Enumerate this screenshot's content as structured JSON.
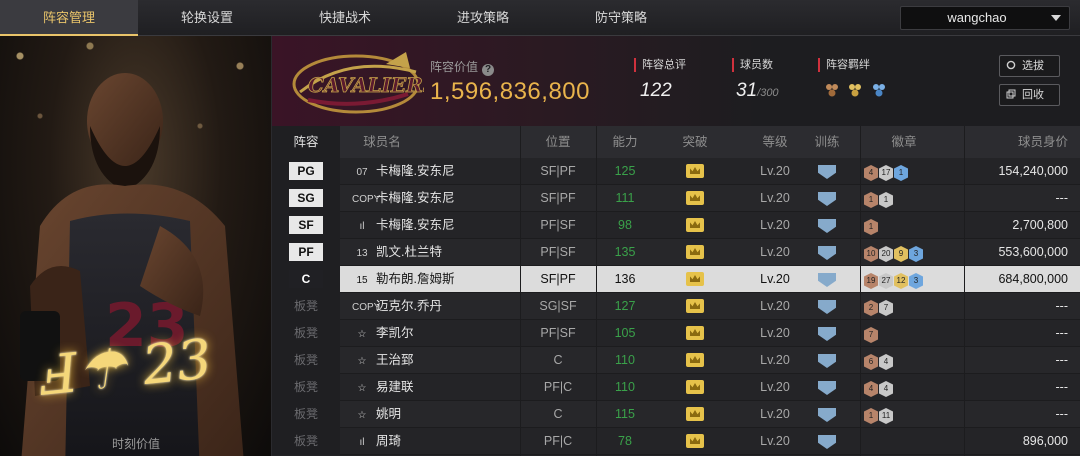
{
  "nav": {
    "tabs": [
      "阵容管理",
      "轮换设置",
      "快捷战术",
      "进攻策略",
      "防守策略"
    ],
    "active": 0,
    "user": "wangchao"
  },
  "card": {
    "jersey_label": "时刻价值"
  },
  "header": {
    "value_label": "阵容价值",
    "value": "1,596,836,800",
    "rating_label": "阵容总评",
    "rating": "122",
    "players_label": "球员数",
    "players": "31",
    "players_max": "/300",
    "chem_label": "阵容羁绊",
    "btn_pick": "选拔",
    "btn_recycle": "回收",
    "team_logo_text": "CAVALIERS"
  },
  "table": {
    "headers": [
      "阵容",
      "球员名",
      "位置",
      "能力",
      "突破",
      "等级",
      "训练",
      "徽章",
      "球员身价"
    ],
    "rows": [
      {
        "slot": "PG",
        "starter": true,
        "card": "07",
        "name": "卡梅隆.安东尼",
        "pos": "SF|PF",
        "rating": "125",
        "level": "Lv.20",
        "badges": [
          [
            "4",
            "b-bronze"
          ],
          [
            "17",
            "b-silver"
          ],
          [
            "1",
            "b-blue"
          ]
        ],
        "salary": "154,240,000"
      },
      {
        "slot": "SG",
        "starter": true,
        "card": "COPY",
        "name": "卡梅隆.安东尼",
        "pos": "SF|PF",
        "rating": "111",
        "level": "Lv.20",
        "badges": [
          [
            "1",
            "b-bronze"
          ],
          [
            "1",
            "b-silver"
          ]
        ],
        "salary": "---"
      },
      {
        "slot": "SF",
        "starter": true,
        "card": "ıl",
        "name": "卡梅隆.安东尼",
        "pos": "PF|SF",
        "rating": "98",
        "level": "Lv.20",
        "badges": [
          [
            "1",
            "b-bronze"
          ]
        ],
        "salary": "2,700,800"
      },
      {
        "slot": "PF",
        "starter": true,
        "card": "13",
        "name": "凯文.杜兰特",
        "pos": "PF|SF",
        "rating": "135",
        "level": "Lv.20",
        "badges": [
          [
            "10",
            "b-bronze"
          ],
          [
            "20",
            "b-silver"
          ],
          [
            "9",
            "b-gold"
          ],
          [
            "3",
            "b-blue"
          ]
        ],
        "salary": "553,600,000"
      },
      {
        "slot": "C",
        "starter": true,
        "selected": true,
        "card": "15",
        "name": "勒布朗.詹姆斯",
        "pos": "SF|PF",
        "rating": "136",
        "level": "Lv.20",
        "badges": [
          [
            "19",
            "b-bronze"
          ],
          [
            "27",
            "b-silver"
          ],
          [
            "12",
            "b-gold"
          ],
          [
            "3",
            "b-blue"
          ]
        ],
        "salary": "684,800,000"
      },
      {
        "slot": "板凳",
        "starter": false,
        "card": "COPY",
        "name": "迈克尔.乔丹",
        "pos": "SG|SF",
        "rating": "127",
        "level": "Lv.20",
        "badges": [
          [
            "2",
            "b-bronze"
          ],
          [
            "7",
            "b-silver"
          ]
        ],
        "salary": "---"
      },
      {
        "slot": "板凳",
        "starter": false,
        "card": "☆",
        "name": "李凯尔",
        "pos": "PF|SF",
        "rating": "105",
        "level": "Lv.20",
        "badges": [
          [
            "7",
            "b-bronze"
          ]
        ],
        "salary": "---"
      },
      {
        "slot": "板凳",
        "starter": false,
        "card": "☆",
        "name": "王治郅",
        "pos": "C",
        "rating": "110",
        "level": "Lv.20",
        "badges": [
          [
            "6",
            "b-bronze"
          ],
          [
            "4",
            "b-silver"
          ]
        ],
        "salary": "---"
      },
      {
        "slot": "板凳",
        "starter": false,
        "card": "☆",
        "name": "易建联",
        "pos": "PF|C",
        "rating": "110",
        "level": "Lv.20",
        "badges": [
          [
            "4",
            "b-bronze"
          ],
          [
            "4",
            "b-silver"
          ]
        ],
        "salary": "---"
      },
      {
        "slot": "板凳",
        "starter": false,
        "card": "☆",
        "name": "姚明",
        "pos": "C",
        "rating": "115",
        "level": "Lv.20",
        "badges": [
          [
            "1",
            "b-bronze"
          ],
          [
            "11",
            "b-silver"
          ]
        ],
        "salary": "---"
      },
      {
        "slot": "板凳",
        "starter": false,
        "card": "ıl",
        "name": "周琦",
        "pos": "PF|C",
        "rating": "78",
        "level": "Lv.20",
        "badges": [],
        "salary": "896,000"
      }
    ]
  }
}
